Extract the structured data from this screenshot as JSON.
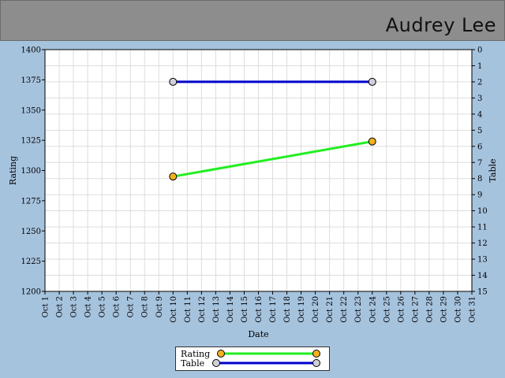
{
  "header": {
    "name": "Audrey Lee"
  },
  "colors": {
    "rating_line": "#22ee22",
    "rating_marker": "#f5b020",
    "table_line": "#0000cc",
    "table_marker": "#d0d0d8",
    "plot_bg": "#ffffff",
    "grid": "#dddddd",
    "page_bg": "#a6c3de",
    "header_bg": "#8d8d8d"
  },
  "chart_data": {
    "type": "line",
    "title": "",
    "xlabel": "Date",
    "ylabel": "Rating",
    "y2label": "Table",
    "categories": [
      "Oct 1",
      "Oct 2",
      "Oct 3",
      "Oct 4",
      "Oct 5",
      "Oct 6",
      "Oct 7",
      "Oct 8",
      "Oct 9",
      "Oct 10",
      "Oct 11",
      "Oct 12",
      "Oct 13",
      "Oct 14",
      "Oct 15",
      "Oct 16",
      "Oct 17",
      "Oct 18",
      "Oct 19",
      "Oct 20",
      "Oct 21",
      "Oct 22",
      "Oct 23",
      "Oct 24",
      "Oct 25",
      "Oct 26",
      "Oct 27",
      "Oct 28",
      "Oct 29",
      "Oct 30",
      "Oct 31"
    ],
    "ylim": [
      1200,
      1400
    ],
    "yticks": [
      1200,
      1225,
      1250,
      1275,
      1300,
      1325,
      1350,
      1375,
      1400
    ],
    "y2lim": [
      0,
      15
    ],
    "y2ticks": [
      0,
      1,
      2,
      3,
      4,
      5,
      6,
      7,
      8,
      9,
      10,
      11,
      12,
      13,
      14,
      15
    ],
    "y2_inverted": true,
    "grid": true,
    "legend_position": "bottom",
    "series": [
      {
        "name": "Rating",
        "axis": "left",
        "points": [
          {
            "x": "Oct 10",
            "y": 1295
          },
          {
            "x": "Oct 24",
            "y": 1324
          }
        ]
      },
      {
        "name": "Table",
        "axis": "right",
        "points": [
          {
            "x": "Oct 10",
            "y": 2
          },
          {
            "x": "Oct 24",
            "y": 2
          }
        ]
      }
    ]
  }
}
